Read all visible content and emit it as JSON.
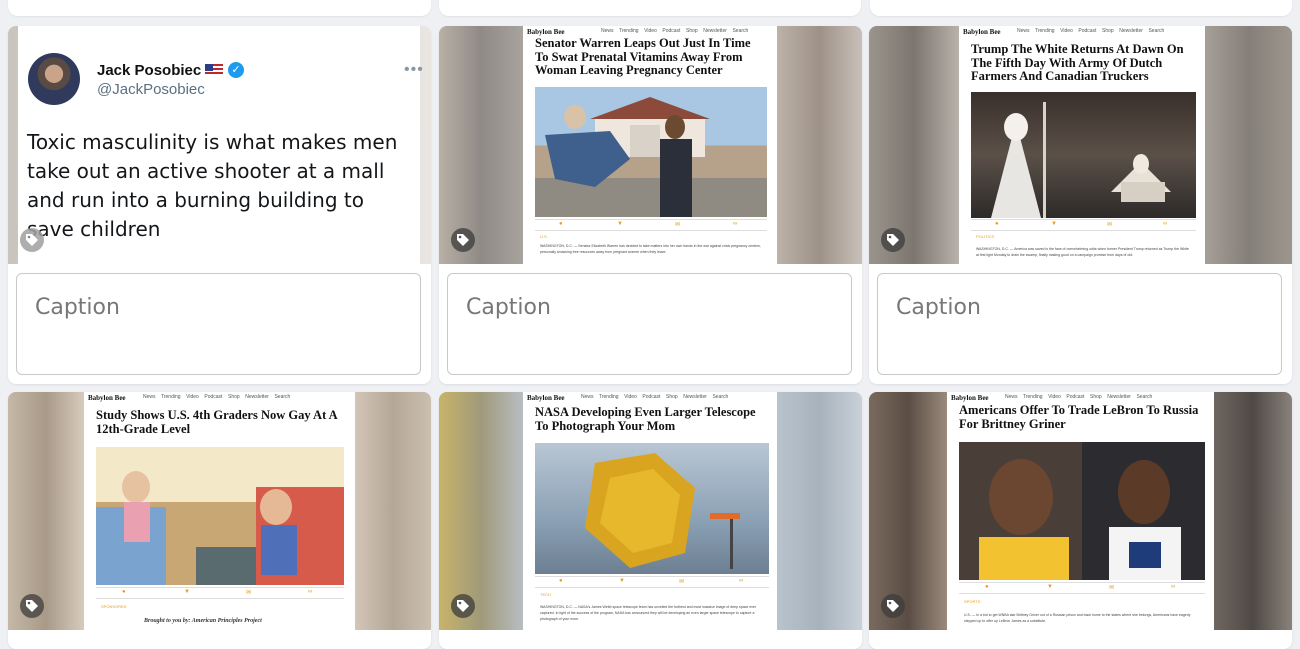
{
  "caption_placeholder": "Caption",
  "tweet": {
    "name": "Jack Posobiec",
    "handle": "@JackPosobiec",
    "more": "•••",
    "text": "Toxic masculinity is what makes men take out an active shooter at a mall and run into a burning building to save children"
  },
  "site": {
    "logo": "Babylon Bee",
    "nav": [
      "News",
      "Trending",
      "Video",
      "Podcast",
      "Shop",
      "Newsletter",
      "Search"
    ]
  },
  "articles": [
    {
      "headline": "Senator Warren Leaps Out Just In Time To Swat Prenatal Vitamins Away From Woman Leaving Pregnancy Center",
      "category": "U.S.",
      "body": "WASHINGTON, D.C. — Senator Elizabeth Warren has decided to take matters into her own hands in the war against crisis pregnancy centers, personally smacking free resources away from pregnant women when they leave."
    },
    {
      "headline": "Trump The White Returns At Dawn On The Fifth Day With Army Of Dutch Farmers And Canadian Truckers",
      "category": "POLITICS",
      "body": "WASHINGTON, D.C. — America was saved in the face of overwhelming odds when former President Trump returned as Trump the White at first light Monday to drain the swamp, finally making good on a campaign promise from days of old."
    },
    {
      "headline": "Study Shows U.S. 4th Graders Now Gay At A 12th-Grade Level",
      "category": "SPONSORED",
      "sponsor": "Brought to you by: American Principles Project"
    },
    {
      "headline": "NASA Developing Even Larger Telescope To Photograph Your Mom",
      "category": "TECH",
      "body": "WASHINGTON, D.C. — NASA's James Webb space telescope team has unveiled the furthest and most massive image of deep space ever captured. In light of the success of the program, NASA has announced they will be developing an even larger space telescope to capture a photograph of your mom."
    },
    {
      "headline": "Americans Offer To Trade LeBron To Russia For Brittney Griner",
      "category": "SPORTS",
      "body": "U.S. — In a bid to get WNBA star Brittney Griner out of a Russian prison and back home to the states where she belongs, Americans have eagerly stepped up to offer up LeBron James as a substitute."
    }
  ],
  "icons": {
    "tag": "tag-icon",
    "share": [
      "facebook-icon",
      "twitter-icon",
      "email-icon",
      "link-icon"
    ]
  }
}
